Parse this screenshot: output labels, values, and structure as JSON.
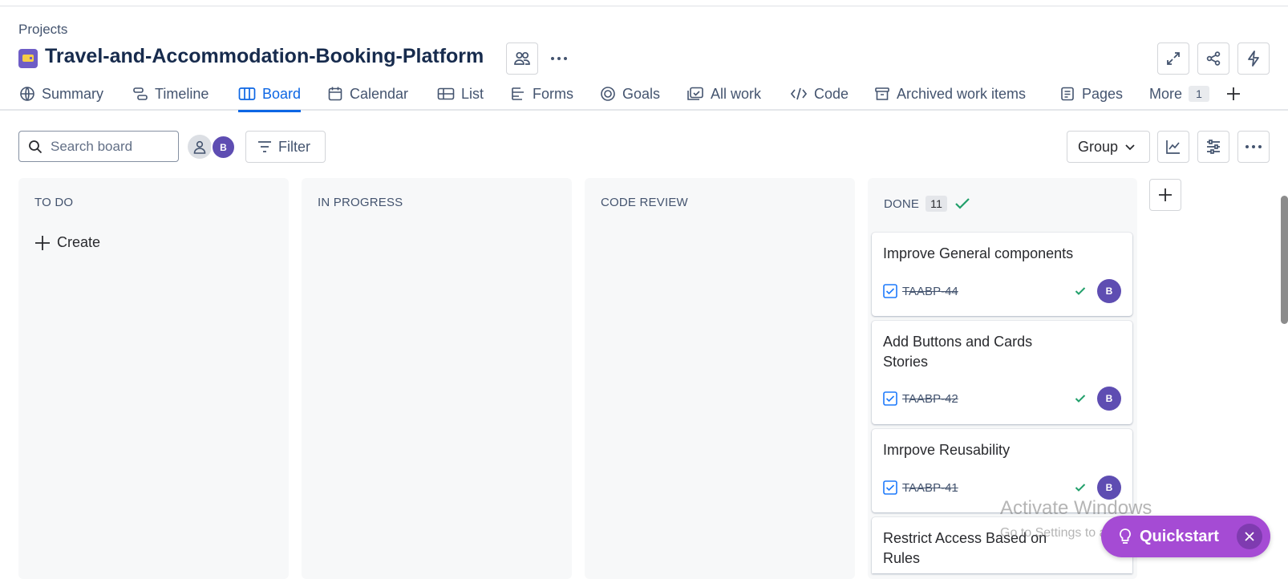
{
  "header": {
    "breadcrumb": "Projects",
    "project_title": "Travel-and-Accommodation-Booking-Platform"
  },
  "tabs": [
    {
      "label": "Summary",
      "icon": "globe-icon"
    },
    {
      "label": "Timeline",
      "icon": "timeline-icon"
    },
    {
      "label": "Board",
      "icon": "board-icon",
      "active": true
    },
    {
      "label": "Calendar",
      "icon": "calendar-icon"
    },
    {
      "label": "List",
      "icon": "list-icon"
    },
    {
      "label": "Forms",
      "icon": "forms-icon"
    },
    {
      "label": "Goals",
      "icon": "goals-icon"
    },
    {
      "label": "All work",
      "icon": "all-work-icon"
    },
    {
      "label": "Code",
      "icon": "code-icon"
    },
    {
      "label": "Archived work items",
      "icon": "archive-icon"
    },
    {
      "label": "Pages",
      "icon": "pages-icon"
    },
    {
      "label": "More",
      "badge": "1"
    }
  ],
  "toolbar": {
    "search_placeholder": "Search board",
    "avatar_initial": "B",
    "filter_label": "Filter",
    "group_label": "Group"
  },
  "columns": [
    {
      "title": "TO DO",
      "create_label": "Create"
    },
    {
      "title": "IN PROGRESS"
    },
    {
      "title": "CODE REVIEW"
    },
    {
      "title": "DONE",
      "count": "11"
    }
  ],
  "cards": [
    {
      "title": "Improve General components",
      "key": "TAABP-44",
      "assignee": "B"
    },
    {
      "title": "Add Buttons and Cards Stories",
      "key": "TAABP-42",
      "assignee": "B"
    },
    {
      "title": "Imrpove Reusability",
      "key": "TAABP-41",
      "assignee": "B"
    },
    {
      "title": "Restrict Access Based on Rules"
    }
  ],
  "watermark": {
    "line1": "Activate Windows",
    "line2": "Go to Settings to activate Windows."
  },
  "quickstart": {
    "label": "Quickstart"
  },
  "colors": {
    "accent": "#0c66e4",
    "avatar": "#5e4db2",
    "done_check": "#22a06b",
    "quickstart": "#a54bd4"
  }
}
